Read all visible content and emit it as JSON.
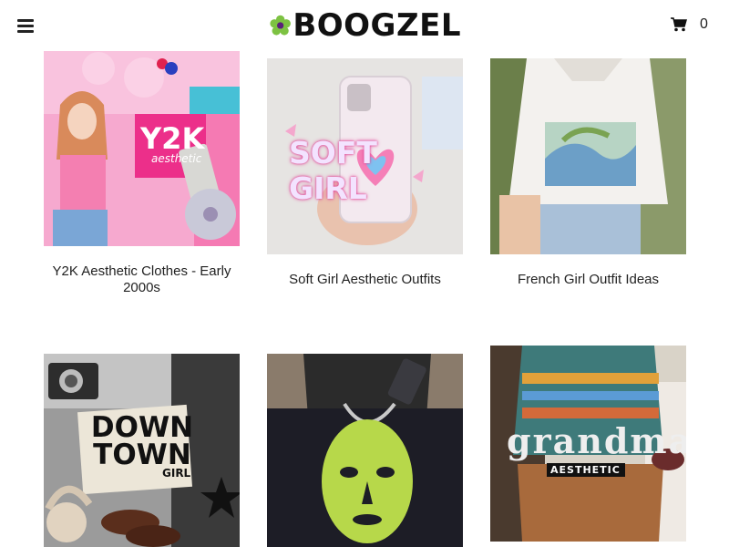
{
  "header": {
    "brand": "BOOGZEL",
    "cart_count": "0",
    "menu_icon": "hamburger-icon",
    "cart_icon": "shopping-cart-icon"
  },
  "colors": {
    "brand_flower": "#7dc242",
    "text": "#222222",
    "background": "#ffffff"
  },
  "collections": [
    {
      "title": "Y2K Aesthetic Clothes - Early 2000s",
      "overlay": "Y2K",
      "overlay_sub": "aesthetic"
    },
    {
      "title": "Soft Girl Aesthetic Outfits",
      "overlay": "SOFT GIRL"
    },
    {
      "title": "French Girl Outfit Ideas"
    },
    {
      "title": "",
      "overlay": "DOWN TOWN",
      "overlay_sub": "GIRL"
    },
    {
      "title": ""
    },
    {
      "title": "",
      "overlay": "grandma",
      "overlay_sub": "AESTHETIC"
    }
  ]
}
